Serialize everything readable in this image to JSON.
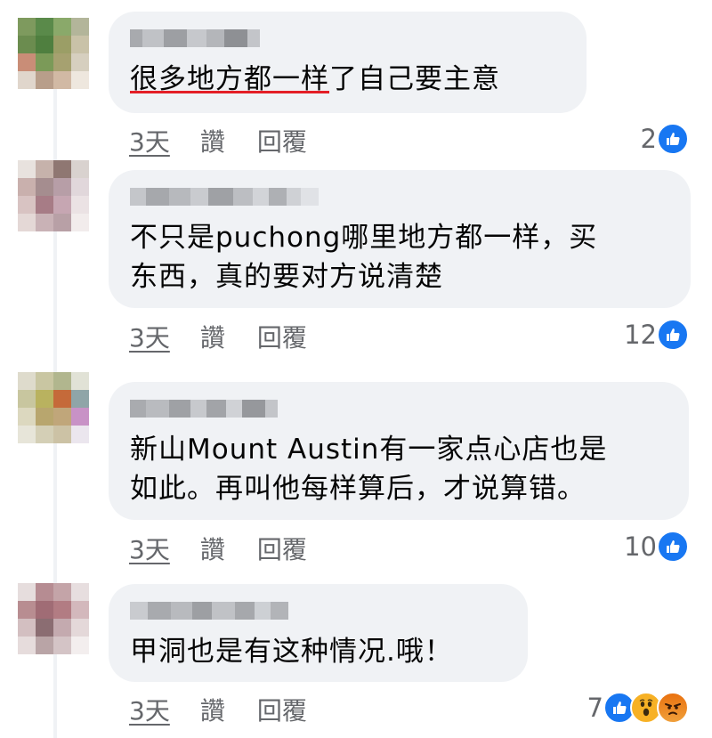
{
  "comments": [
    {
      "text_underlined": "很多地方都一样",
      "text_rest": "了自己要主意",
      "time": "3天",
      "like_label": "讚",
      "reply_label": "回覆",
      "reaction_count": "2",
      "reactions": [
        "like-icon"
      ]
    },
    {
      "text": "不只是puchong哪里地方都一样，买\n东西，真的要对方说清楚",
      "time": "3天",
      "like_label": "讚",
      "reply_label": "回覆",
      "reaction_count": "12",
      "reactions": [
        "like-icon"
      ]
    },
    {
      "text": "新山Mount Austin有一家点心店也是\n如此。再叫他每样算后，才说算错。",
      "time": "3天",
      "like_label": "讚",
      "reply_label": "回覆",
      "reaction_count": "10",
      "reactions": [
        "like-icon"
      ]
    },
    {
      "text": "甲洞也是有这种情况.哦！",
      "time": "3天",
      "like_label": "讚",
      "reply_label": "回覆",
      "reaction_count": "7",
      "reactions": [
        "like-icon",
        "wow-icon",
        "angry-icon"
      ]
    }
  ],
  "colors": {
    "bubble": "#f0f2f5",
    "secondary_text": "#65676b",
    "like_blue": "#1877f2",
    "underline_red": "#e41e26"
  }
}
